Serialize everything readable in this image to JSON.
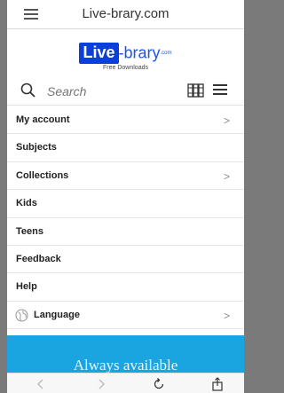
{
  "browser": {
    "url": "Live-brary.com"
  },
  "logo": {
    "live": "Live",
    "brary": "-brary",
    "tld": ".com",
    "tagline": "Free Downloads"
  },
  "search": {
    "placeholder": "Search"
  },
  "nav": {
    "items": [
      {
        "label": "My account",
        "chevron": true
      },
      {
        "label": "Subjects",
        "chevron": false
      },
      {
        "label": "Collections",
        "chevron": true
      },
      {
        "label": "Kids",
        "chevron": false
      },
      {
        "label": "Teens",
        "chevron": false
      },
      {
        "label": "Feedback",
        "chevron": false
      },
      {
        "label": "Help",
        "chevron": false
      },
      {
        "label": "Language",
        "chevron": true
      }
    ]
  },
  "banner": {
    "text": "Always available"
  },
  "icons": {
    "top_left": "hamburger-icon",
    "search": "search-icon",
    "books": "books-icon",
    "menu": "menu-icon",
    "language": "globe-icon",
    "bottom": [
      "back-icon",
      "forward-icon",
      "reload-icon",
      "share-icon"
    ]
  },
  "colors": {
    "banner": "#1aa4e0",
    "logo_blue": "#0b3fd9"
  }
}
